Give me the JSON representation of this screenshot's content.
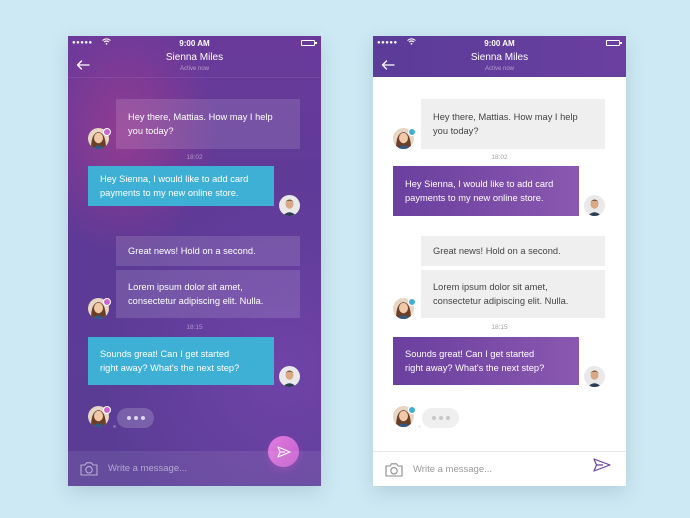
{
  "status_bar": {
    "signal": "●●●●●",
    "time": "9:00 AM"
  },
  "conversation": {
    "contact_name": "Sienna Miles",
    "contact_status": "Active now",
    "messages": [
      {
        "from": "agent",
        "text": "Hey there, Mattias. How may I help you today?",
        "lines": [
          "Hey there, Mattias. How may I help",
          "you today?"
        ]
      },
      {
        "time": "18:02"
      },
      {
        "from": "user",
        "text": "Hey Sienna, I would like to add card payments to my new online store.",
        "lines": [
          "Hey Sienna, I would like to add card",
          "payments to my new online store."
        ]
      },
      {
        "from": "agent",
        "text": "Great news! Hold on a second.",
        "lines": [
          "Great news! Hold on a second."
        ]
      },
      {
        "from": "agent",
        "text": "Lorem ipsum dolor sit amet, consectetur adipiscing elit. Nulla.",
        "lines": [
          "Lorem ipsum dolor sit amet,",
          "consectetur adipiscing elit. Nulla."
        ]
      },
      {
        "time": "18:15"
      },
      {
        "from": "user",
        "text": "Sounds great! Can I get started right away? What's the next step?",
        "lines": [
          "Sounds great! Can I get started",
          "right away? What's the next step?"
        ]
      },
      {
        "from": "agent",
        "typing": true
      }
    ],
    "input_placeholder": "Write a message..."
  },
  "icons": {
    "back": "back-arrow-icon",
    "send": "send-icon",
    "camera": "camera-icon",
    "typing": "typing-dots-icon"
  },
  "colors": {
    "background": "#cde9f3",
    "dark_theme_bg": "#5d3a96",
    "dark_user_bubble": "#3fb0d5",
    "light_header": "#5b3c98",
    "light_user_bubble": "#7a4ba8",
    "light_agent_bubble": "#efefef",
    "fab": "#d06ed6"
  }
}
